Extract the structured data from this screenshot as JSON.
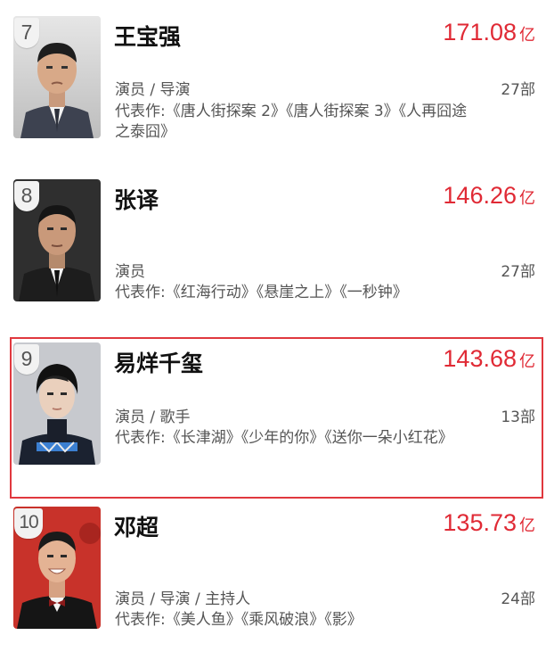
{
  "entries": [
    {
      "rank": "7",
      "name": "王宝强",
      "box_office": "171.08",
      "unit": "亿",
      "roles": "演员 / 导演",
      "count": "27部",
      "works": "代表作:《唐人街探案 2》《唐人街探案 3》《人再囧途之泰囧》",
      "highlighted": false
    },
    {
      "rank": "8",
      "name": "张译",
      "box_office": "146.26",
      "unit": "亿",
      "roles": "演员",
      "count": "27部",
      "works": "代表作:《红海行动》《悬崖之上》《一秒钟》",
      "highlighted": false
    },
    {
      "rank": "9",
      "name": "易烊千玺",
      "box_office": "143.68",
      "unit": "亿",
      "roles": "演员 / 歌手",
      "count": "13部",
      "works": "代表作:《长津湖》《少年的你》《送你一朵小红花》",
      "highlighted": true
    },
    {
      "rank": "10",
      "name": "邓超",
      "box_office": "135.73",
      "unit": "亿",
      "roles": "演员 / 导演 / 主持人",
      "count": "24部",
      "works": "代表作:《美人鱼》《乘风破浪》《影》",
      "highlighted": false
    }
  ],
  "colors": {
    "accent": "#e02a35",
    "highlight_border": "#e0383e",
    "secondary_text": "#555555"
  }
}
